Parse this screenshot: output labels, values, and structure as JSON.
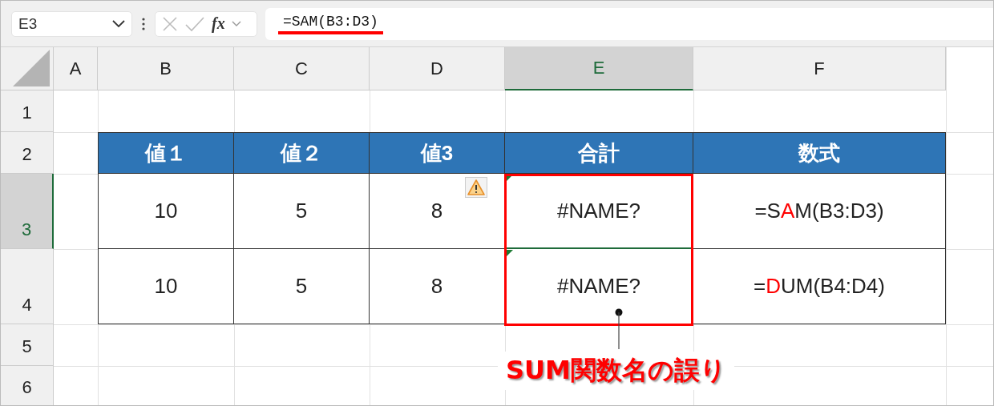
{
  "formula_toolbar": {
    "name_box": "E3",
    "function_button": "fx",
    "formula": "=SAM(B3:D3)",
    "formula_underlined": true
  },
  "sheet": {
    "columns": [
      {
        "label": "A",
        "selected": false
      },
      {
        "label": "B",
        "selected": false
      },
      {
        "label": "C",
        "selected": false
      },
      {
        "label": "D",
        "selected": false
      },
      {
        "label": "E",
        "selected": true
      },
      {
        "label": "F",
        "selected": false
      }
    ],
    "rows": [
      {
        "label": "1",
        "selected": false
      },
      {
        "label": "2",
        "selected": false
      },
      {
        "label": "3",
        "selected": true
      },
      {
        "label": "4",
        "selected": false
      },
      {
        "label": "5",
        "selected": false
      },
      {
        "label": "6",
        "selected": false
      }
    ],
    "error_options_button": true
  },
  "table": {
    "header": [
      "値１",
      "値２",
      "値3",
      "合計",
      "数式"
    ],
    "rows": [
      [
        {
          "text": "10"
        },
        {
          "text": "5"
        },
        {
          "text": "8"
        },
        {
          "text": "#NAME?",
          "error_flag": true
        },
        {
          "parts": [
            {
              "text": "=S",
              "highlight": false
            },
            {
              "text": "A",
              "highlight": true
            },
            {
              "text": "M(B3:D3)",
              "highlight": false
            }
          ]
        }
      ],
      [
        {
          "text": "10"
        },
        {
          "text": "5"
        },
        {
          "text": "8"
        },
        {
          "text": "#NAME?",
          "error_flag": true
        },
        {
          "parts": [
            {
              "text": "=",
              "highlight": false
            },
            {
              "text": "D",
              "highlight": true
            },
            {
              "text": "UM(B4:D4)",
              "highlight": false
            }
          ]
        }
      ]
    ]
  },
  "annotation": {
    "text": "SUM関数名の誤り"
  }
}
